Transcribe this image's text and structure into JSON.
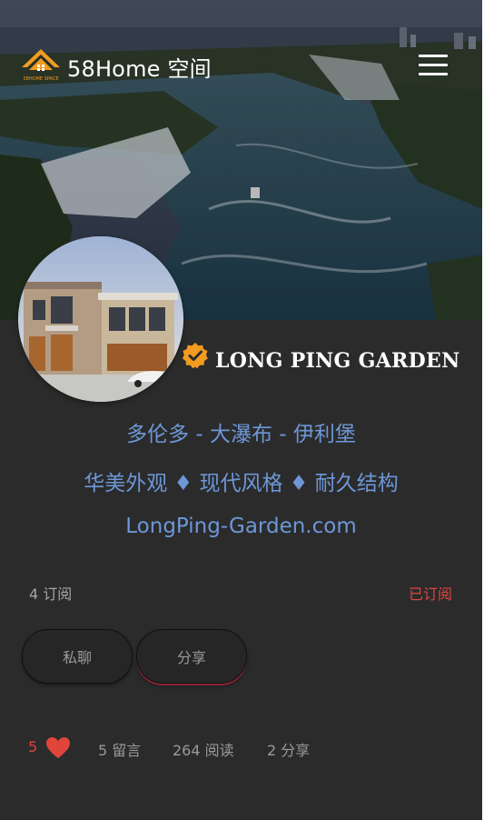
{
  "header": {
    "brand": "58Home 空间",
    "logo_text": "58HOME SPACE"
  },
  "profile": {
    "name": "LONG PING GARDEN",
    "location": "多伦多 - 大瀑布 - 伊利堡",
    "features": "华美外观 ♦ 现代风格 ♦ 耐久结构",
    "website": "LongPing-Garden.com"
  },
  "subscription": {
    "count_label": "4  订阅",
    "status": "已订阅"
  },
  "actions": {
    "chat": "私聊",
    "share": "分享"
  },
  "stats": {
    "likes": "5",
    "comments": "5 留言",
    "reads": "264 阅读",
    "shares": "2 分享"
  },
  "colors": {
    "accent_red": "#e0453c",
    "link_blue": "#6d97d6",
    "verified_orange": "#f29b1f",
    "background": "#2b2b2c"
  }
}
